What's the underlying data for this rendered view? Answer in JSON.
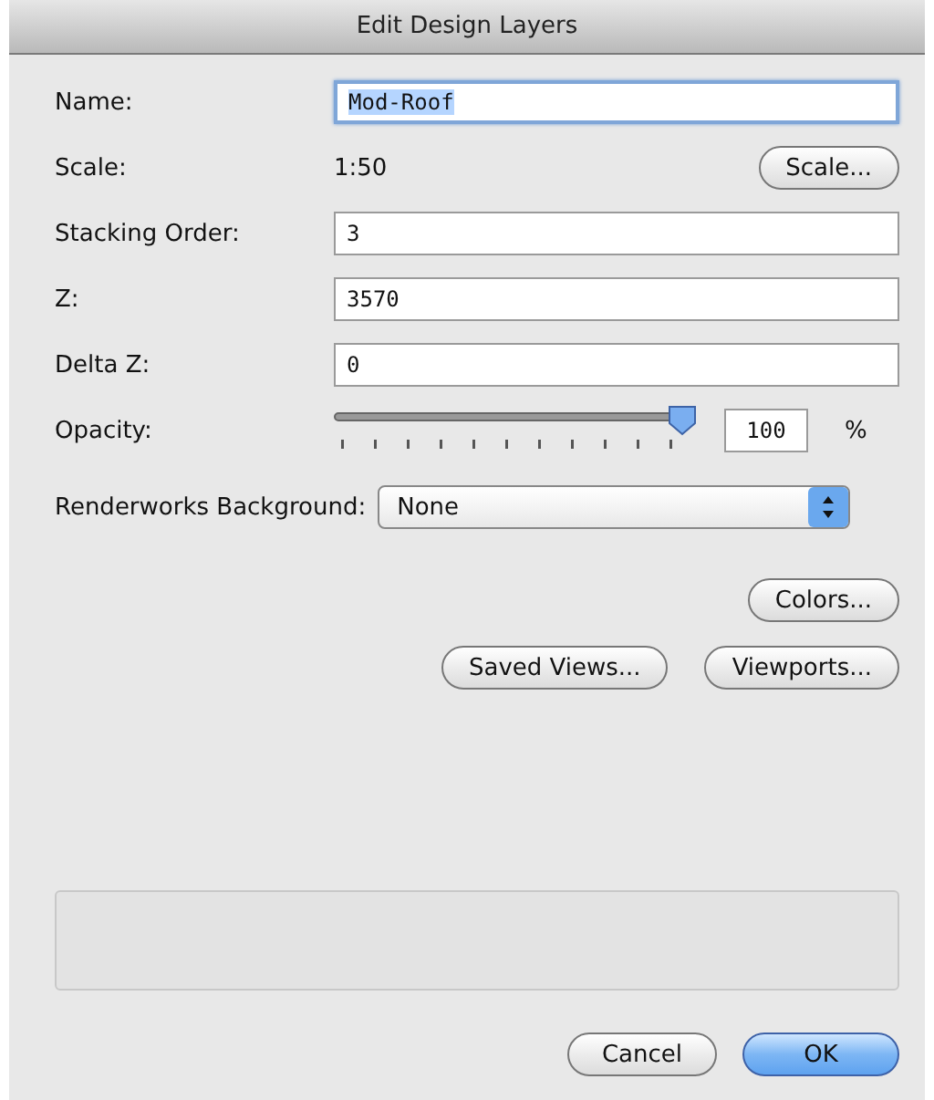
{
  "window": {
    "title": "Edit Design Layers"
  },
  "rows": [
    {
      "kind": "text",
      "label": "Name:",
      "value": "Mod-Roof",
      "focused": true
    },
    {
      "kind": "readout",
      "label": "Scale:",
      "value": "1:50",
      "button": "Scale..."
    },
    {
      "kind": "text",
      "label": "Stacking Order:",
      "value": "3",
      "focused": false
    },
    {
      "kind": "text",
      "label": "Z:",
      "value": "3570",
      "focused": false
    },
    {
      "kind": "text",
      "label": "Delta Z:",
      "value": "0",
      "focused": false
    },
    {
      "kind": "slider",
      "label": "Opacity:",
      "level": 1,
      "value": "100",
      "unit": "%"
    },
    {
      "kind": "popup",
      "label": "Renderworks Background:",
      "value": "None"
    }
  ],
  "button_rows": [
    {
      "buttons": [
        "Colors..."
      ]
    },
    {
      "buttons": [
        "Saved Views...",
        "Viewports..."
      ]
    }
  ],
  "footer_buttons": [
    {
      "label": "Cancel",
      "default": false
    },
    {
      "label": "OK",
      "default": true
    }
  ]
}
